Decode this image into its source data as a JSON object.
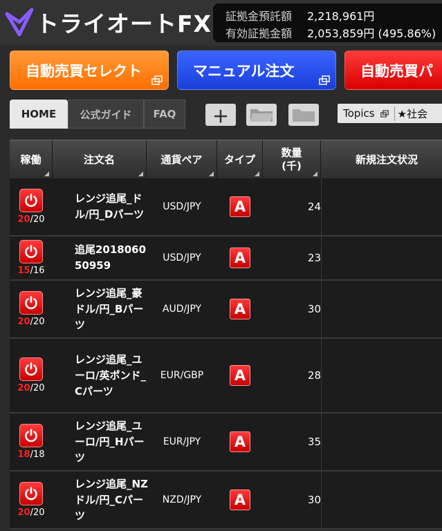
{
  "header": {
    "logo_text": "トライオートFX",
    "account": {
      "margin_deposit_label": "証拠金預託額",
      "margin_deposit_value": "2,218,961円",
      "effective_margin_label": "有効証拠金額",
      "effective_margin_value": "2,053,859円 (495.86%)"
    }
  },
  "buttons": {
    "auto_select": "自動売買セレクト",
    "manual_order": "マニュアル注文",
    "auto_trade_partial": "自動売買パ"
  },
  "tabs": {
    "home": "HOME",
    "guide": "公式ガイド",
    "faq": "FAQ",
    "plus_icon": "＋",
    "topics_label": "Topics",
    "topics_news": "★社会"
  },
  "table": {
    "headers": {
      "status": "稼働",
      "order_name": "注文名",
      "pair": "通貨ペア",
      "type": "タイプ",
      "qty_line1": "数量",
      "qty_line2": "(千)",
      "new_order_status": "新規注文状況"
    },
    "rows": [
      {
        "active": "20",
        "total": "/20",
        "name": "レンジ追尾_ドル/円_Dパーツ",
        "pair": "USD/JPY",
        "type": "A",
        "qty": "24"
      },
      {
        "active": "15",
        "total": "/16",
        "name": "追尾201806050959",
        "pair": "USD/JPY",
        "type": "A",
        "qty": "23"
      },
      {
        "active": "20",
        "total": "/20",
        "name": "レンジ追尾_豪ドル/円_Bパーツ",
        "pair": "AUD/JPY",
        "type": "A",
        "qty": "30"
      },
      {
        "active": "20",
        "total": "/20",
        "name": "レンジ追尾_ユーロ/英ポンド_Cパーツ",
        "pair": "EUR/GBP",
        "type": "A",
        "qty": "28"
      },
      {
        "active": "18",
        "total": "/18",
        "name": "レンジ追尾_ユーロ/円_Hパーツ",
        "pair": "EUR/JPY",
        "type": "A",
        "qty": "35"
      },
      {
        "active": "20",
        "total": "/20",
        "name": "レンジ追尾_NZドル/円_Cパーツ",
        "pair": "NZD/JPY",
        "type": "A",
        "qty": "30"
      }
    ]
  },
  "colors": {
    "accent_orange": "#ff6f00",
    "accent_blue": "#1a3fd9",
    "accent_red": "#d80000",
    "logo_purple": "#8a5cff"
  }
}
